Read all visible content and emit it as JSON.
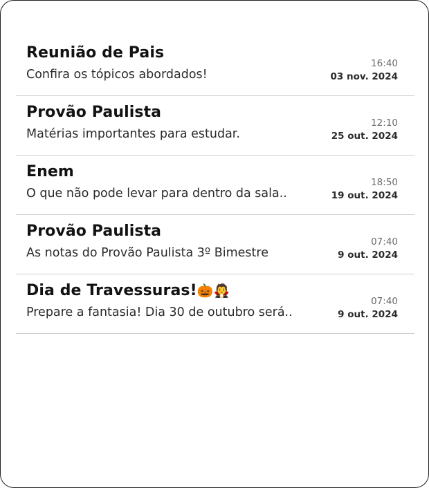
{
  "messages": [
    {
      "title": "Reunião de Pais",
      "title_emoji": "",
      "preview": "Confira os tópicos abordados!",
      "time": "16:40",
      "date": "03 nov. 2024"
    },
    {
      "title": "Provão Paulista",
      "title_emoji": "",
      "preview": "Matérias importantes para estudar.",
      "time": "12:10",
      "date": "25 out. 2024"
    },
    {
      "title": "Enem",
      "title_emoji": "",
      "preview": "O que não pode levar para dentro da sala..",
      "time": "18:50",
      "date": "19 out. 2024"
    },
    {
      "title": "Provão Paulista",
      "title_emoji": "",
      "preview": "As notas do Provão Paulista 3º Bimestre",
      "time": "07:40",
      "date": "9 out. 2024"
    },
    {
      "title": "Dia de Travessuras!",
      "title_emoji": "🎃🧛",
      "preview": "Prepare a fantasia! Dia 30 de outubro será..",
      "time": "07:40",
      "date": "9 out. 2024"
    }
  ]
}
